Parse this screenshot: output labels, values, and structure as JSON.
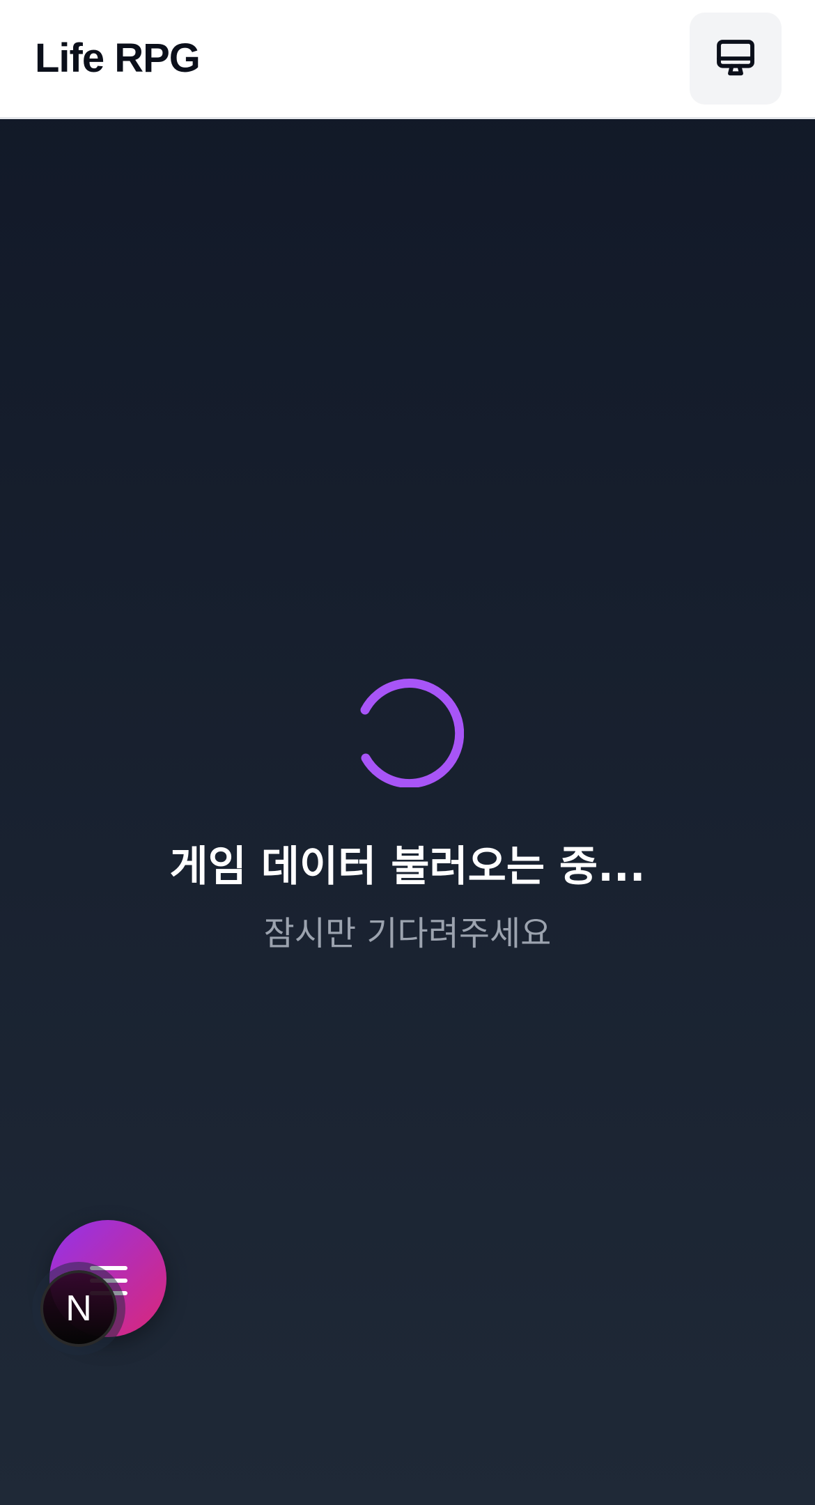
{
  "header": {
    "title": "Life RPG",
    "device_icon": "monitor-icon"
  },
  "loading": {
    "title": "게임 데이터 불러오는 중...",
    "subtitle": "잠시만 기다려주세요",
    "spinner_color": "#a855f7"
  },
  "fab": {
    "icon": "menu-icon"
  },
  "dev_badge": {
    "letter": "N"
  }
}
